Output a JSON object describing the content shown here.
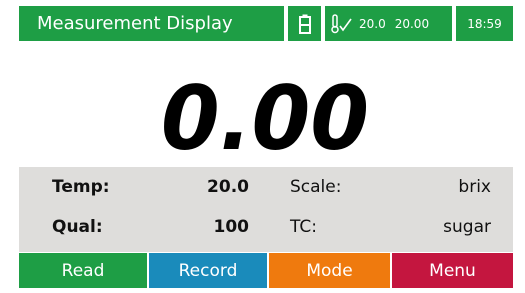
{
  "header": {
    "title": "Measurement Display",
    "battery_icon": "battery-icon",
    "thermometer_icon": "thermometer-check-icon",
    "temp_value": "20.0",
    "temp_setpoint": "20.00",
    "time": "18:59"
  },
  "reading": {
    "value": "0.00"
  },
  "info": {
    "temp_label": "Temp:",
    "temp_value": "20.0",
    "scale_label": "Scale:",
    "scale_value": "brix",
    "qual_label": "Qual:",
    "qual_value": "100",
    "tc_label": "TC:",
    "tc_value": "sugar"
  },
  "buttons": {
    "read": "Read",
    "record": "Record",
    "mode": "Mode",
    "menu": "Menu"
  },
  "colors": {
    "header_green": "#1e9e45",
    "read_green": "#1e9e45",
    "record_blue": "#1a8bbb",
    "mode_orange": "#ef7a0e",
    "menu_red": "#c4163f",
    "panel_gray": "#dedddb"
  }
}
